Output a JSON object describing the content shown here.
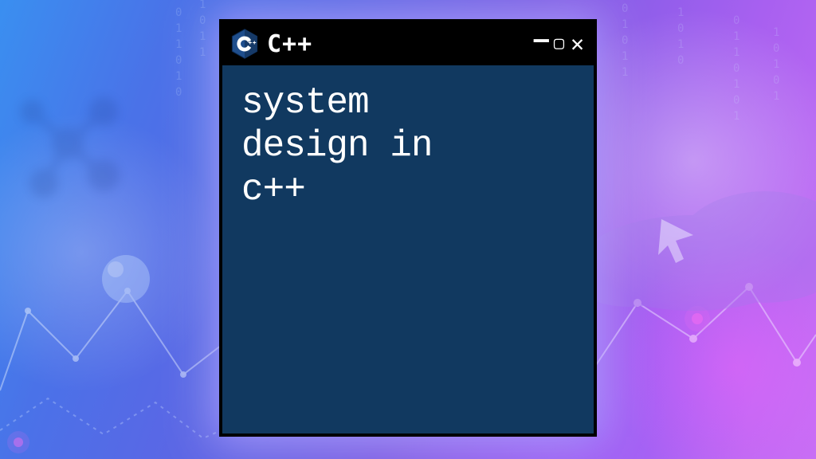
{
  "window": {
    "title": "C++",
    "body_text": "system\ndesign in\nc++",
    "icon_name": "cpp-logo-icon",
    "controls": {
      "minimize": "—",
      "maximize": "▢",
      "close": "✕"
    }
  },
  "colors": {
    "terminal_bg": "#113960",
    "titlebar_bg": "#000000",
    "text": "#ffffff"
  }
}
